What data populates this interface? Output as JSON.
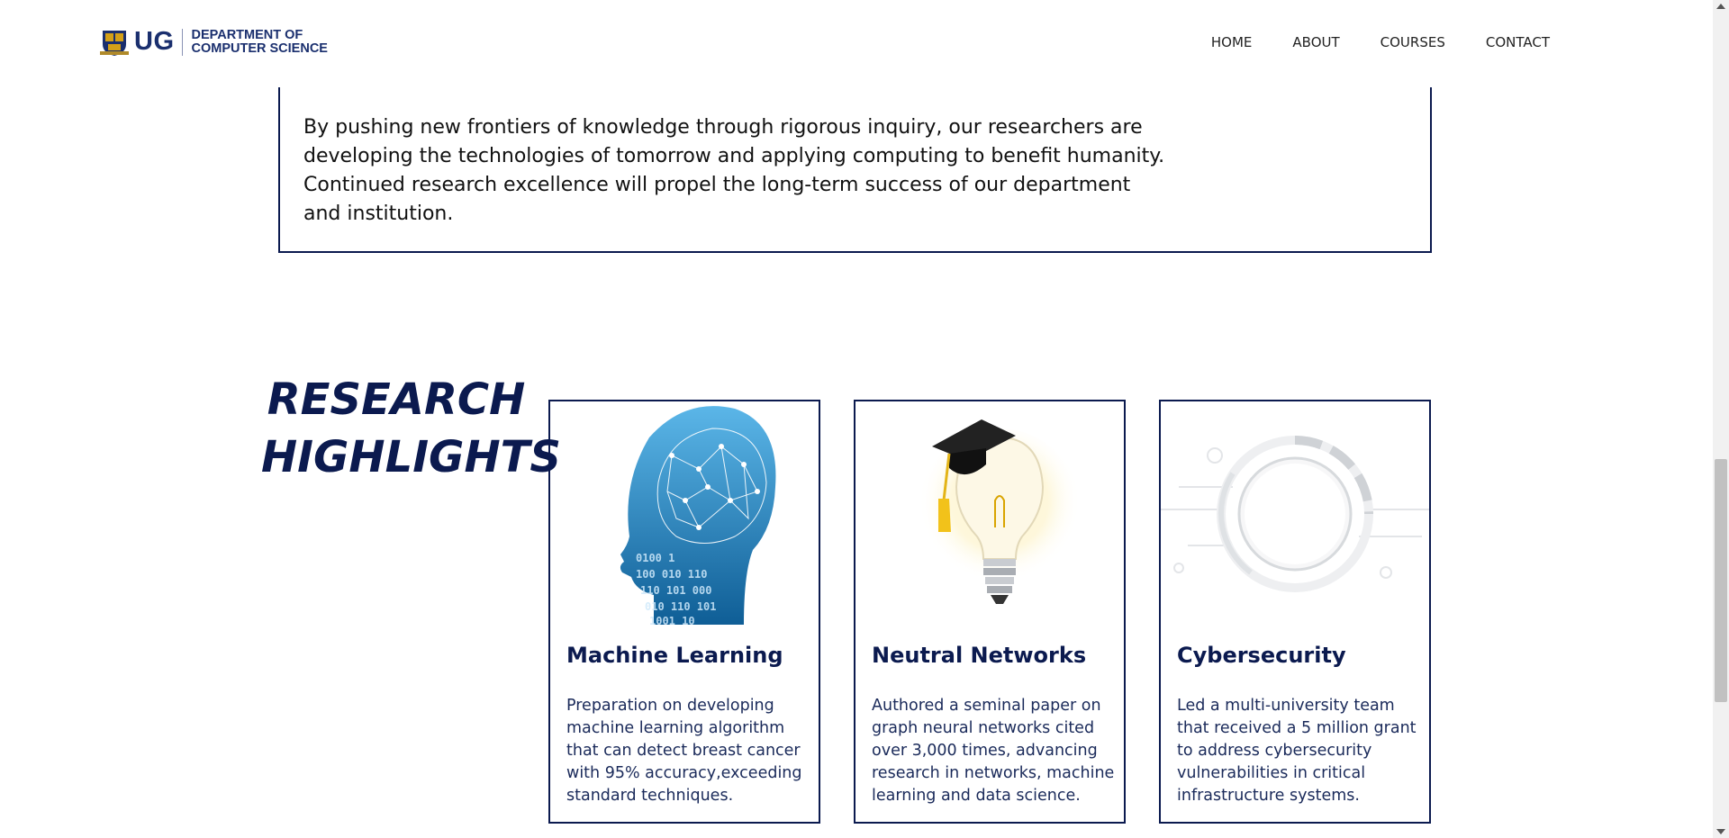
{
  "header": {
    "logo_ug": "UG",
    "logo_dept_line1": "DEPARTMENT OF",
    "logo_dept_line2": "COMPUTER SCIENCE",
    "nav": [
      "HOME",
      "ABOUT",
      "COURSES",
      "CONTACT"
    ]
  },
  "intro": {
    "text": "By pushing new frontiers of knowledge through rigorous inquiry, our researchers are developing the technologies of tomorrow and applying computing to benefit humanity. Continued research excellence will propel the long-term success of our department and institution."
  },
  "research": {
    "title_line1": "RESEARCH",
    "title_line2": "HIGHLIGHTS",
    "cards": [
      {
        "title": "Machine Learning",
        "text": "Preparation on developing machine learning algorithm that can detect breast cancer with 95% accuracy,exceeding standard techniques.",
        "image": "brain-head-icon"
      },
      {
        "title": "Neutral Networks",
        "text": "Authored a seminal paper on graph neural networks cited over 3,000 times, advancing research in networks, machine learning and data science.",
        "image": "lightbulb-graduation-cap-icon"
      },
      {
        "title": "Cybersecurity",
        "text": "Led a multi-university team that received a 5 million grant to address cybersecurity vulnerabilities in critical infrastructure systems.",
        "image": "circuit-ring-icon"
      }
    ]
  },
  "colors": {
    "brand_navy": "#0b1a4f",
    "brain_blue": "#1e88c8"
  }
}
